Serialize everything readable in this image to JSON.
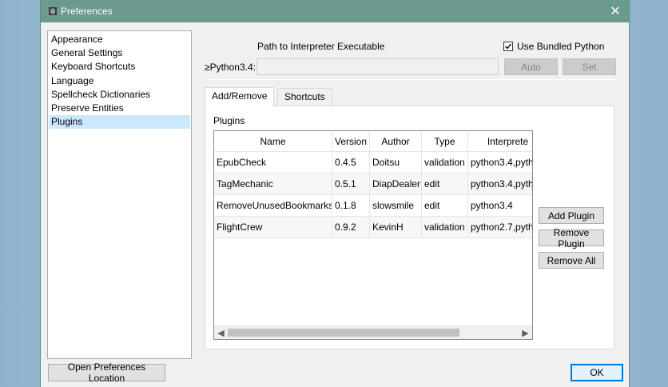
{
  "window": {
    "title": "Preferences",
    "close_glyph": "✕"
  },
  "categories": [
    {
      "label": "Appearance",
      "selected": false
    },
    {
      "label": "General Settings",
      "selected": false
    },
    {
      "label": "Keyboard Shortcuts",
      "selected": false
    },
    {
      "label": "Language",
      "selected": false
    },
    {
      "label": "Spellcheck Dictionaries",
      "selected": false
    },
    {
      "label": "Preserve Entities",
      "selected": false
    },
    {
      "label": "Plugins",
      "selected": true
    }
  ],
  "interpreter": {
    "path_label": "Path to Interpreter Executable",
    "bundled_label": "Use Bundled Python",
    "bundled_checked": true,
    "version_label": "≥Python3.4:",
    "path_value": "",
    "auto_label": "Auto",
    "set_label": "Set"
  },
  "tabs": [
    {
      "label": "Add/Remove",
      "active": true
    },
    {
      "label": "Shortcuts",
      "active": false
    }
  ],
  "plugins": {
    "section_label": "Plugins",
    "columns": [
      "Name",
      "Version",
      "Author",
      "Type",
      "Interprete"
    ],
    "rows": [
      [
        "EpubCheck",
        "0.4.5",
        "Doitsu",
        "validation",
        "python3.4,pyth"
      ],
      [
        "TagMechanic",
        "0.5.1",
        "DiapDealer",
        "edit",
        "python3.4,pyth"
      ],
      [
        "RemoveUnusedBookmarks",
        "0.1.8",
        "slowsmile",
        "edit",
        "python3.4"
      ],
      [
        "FlightCrew",
        "0.9.2",
        "KevinH",
        "validation",
        "python2.7,pyth"
      ]
    ],
    "add_label": "Add Plugin",
    "remove_label": "Remove Plugin",
    "remove_all_label": "Remove All"
  },
  "footer": {
    "open_location_label": "Open Preferences Location",
    "ok_label": "OK"
  },
  "colors": {
    "titlebar": "#6b9a8e",
    "selection": "#cce8ff",
    "focus": "#0078d7"
  }
}
